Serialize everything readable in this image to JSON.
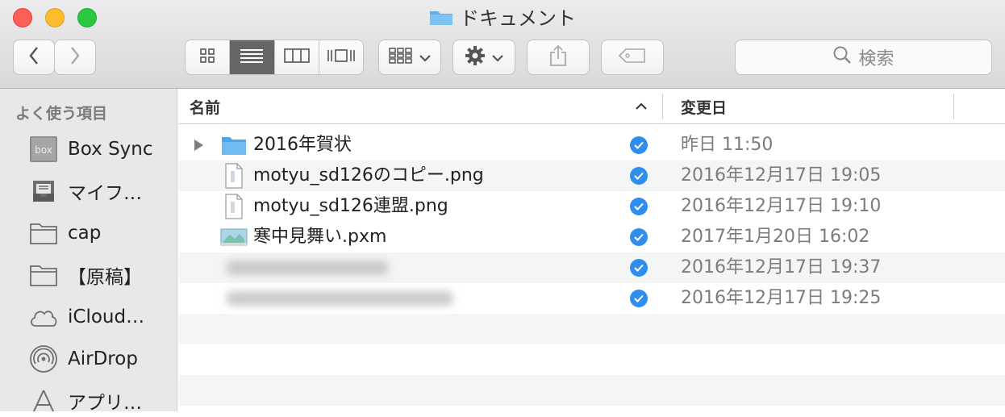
{
  "window": {
    "title": "ドキュメント"
  },
  "toolbar": {
    "back_icon": "chevron-left-icon",
    "forward_icon": "chevron-right-icon",
    "view_modes": [
      "icon-view-icon",
      "list-view-icon",
      "column-view-icon",
      "cover-flow-icon"
    ],
    "active_view": "list-view-icon",
    "arrange_icon": "arrange-grid-icon",
    "action_icon": "gear-icon",
    "share_icon": "share-icon",
    "tag_icon": "tag-icon",
    "search_placeholder": "検索"
  },
  "sidebar": {
    "section_title": "よく使う項目",
    "items": [
      {
        "label": "Box Sync",
        "icon": "box-sync-icon"
      },
      {
        "label": "マイフ…",
        "icon": "inbox-tray-icon"
      },
      {
        "label": "cap",
        "icon": "folder-icon"
      },
      {
        "label": "【原稿】",
        "icon": "folder-icon"
      },
      {
        "label": "iCloud…",
        "icon": "cloud-icon"
      },
      {
        "label": "AirDrop",
        "icon": "airdrop-icon"
      },
      {
        "label": "アプリ…",
        "icon": "applications-icon"
      }
    ]
  },
  "columns": {
    "name": "名前",
    "date": "変更日"
  },
  "files": [
    {
      "name": "2016年賀状",
      "date": "昨日 11:50",
      "kind": "folder",
      "synced": true
    },
    {
      "name": "motyu_sd126のコピー.png",
      "date": "2016年12月17日 19:05",
      "kind": "image",
      "synced": true
    },
    {
      "name": "motyu_sd126連盟.png",
      "date": "2016年12月17日 19:10",
      "kind": "image",
      "synced": true
    },
    {
      "name": "寒中見舞い.pxm",
      "date": "2017年1月20日 16:02",
      "kind": "pixelmator",
      "synced": true
    },
    {
      "name": "",
      "date": "2016年12月17日 19:37",
      "kind": "blurred",
      "synced": true
    },
    {
      "name": "",
      "date": "2016年12月17日 19:25",
      "kind": "blurred",
      "synced": true
    }
  ],
  "colors": {
    "accent": "#2d8ef0",
    "folder": "#5bb0ee",
    "sidebar_bg": "#e8e8e8",
    "row_alt": "#f4f5f5"
  }
}
